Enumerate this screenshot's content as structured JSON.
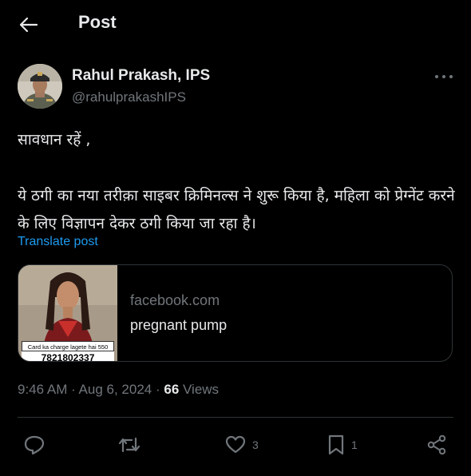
{
  "header": {
    "title": "Post",
    "back_icon": "arrow-left-icon"
  },
  "author": {
    "name": "Rahul Prakash, IPS",
    "handle": "@rahulprakashIPS",
    "more_icon": "more-horizontal-icon"
  },
  "post": {
    "text": "सावधान रहें ,\n\nये ठगी का नया तरीक़ा साइबर क्रिमिनल्स ने शुरू किया है, महिला को प्रेग्नेंट करने के लिए विज्ञापन देकर ठगी किया जा रहा है।",
    "translate_label": "Translate post"
  },
  "link_card": {
    "domain": "facebook.com",
    "title": "pregnant pump",
    "thumb_caption": "Card ka charge lagete hai 550",
    "thumb_phone": "7821802337"
  },
  "meta": {
    "time": "9:46 AM",
    "separator": " · ",
    "date": "Aug 6, 2024",
    "views_count": "66",
    "views_label": " Views"
  },
  "actions": {
    "reply": {
      "icon": "reply-icon",
      "count": ""
    },
    "repost": {
      "icon": "repost-icon",
      "count": ""
    },
    "like": {
      "icon": "heart-icon",
      "count": "3"
    },
    "bookmark": {
      "icon": "bookmark-icon",
      "count": "1"
    },
    "share": {
      "icon": "share-icon",
      "count": ""
    }
  },
  "colors": {
    "background": "#000000",
    "text": "#e7e9ea",
    "secondary": "#71767b",
    "link": "#1d9bf0",
    "border": "#2f3336"
  }
}
